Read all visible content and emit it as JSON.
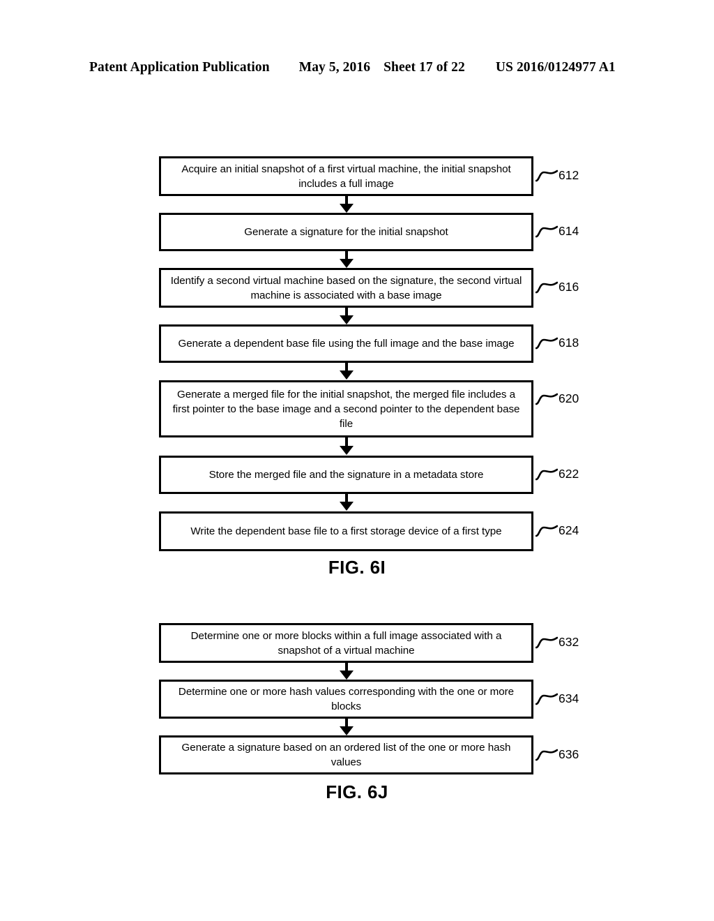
{
  "header": {
    "publication": "Patent Application Publication",
    "date": "May 5, 2016",
    "sheet": "Sheet 17 of 22",
    "patent_number": "US 2016/0124977 A1"
  },
  "figures": [
    {
      "caption": "FIG. 6I",
      "steps": [
        {
          "ref": "612",
          "text": "Acquire an initial snapshot of a first virtual machine, the initial snapshot includes a full image"
        },
        {
          "ref": "614",
          "text": "Generate a signature for the initial snapshot"
        },
        {
          "ref": "616",
          "text": "Identify a second virtual machine based on the signature, the second virtual machine is associated with a base image"
        },
        {
          "ref": "618",
          "text": "Generate a dependent base file using the full image and the base image"
        },
        {
          "ref": "620",
          "text": "Generate a merged file for the initial snapshot, the merged file includes a first pointer to the base image and a second pointer to the dependent base file"
        },
        {
          "ref": "622",
          "text": "Store the merged file and the signature in a metadata store"
        },
        {
          "ref": "624",
          "text": "Write the dependent base file to a first storage device of a first type"
        }
      ]
    },
    {
      "caption": "FIG. 6J",
      "steps": [
        {
          "ref": "632",
          "text": "Determine one or more blocks within a full image associated with a snapshot of a virtual machine"
        },
        {
          "ref": "634",
          "text": "Determine one or more hash values corresponding with the one or more blocks"
        },
        {
          "ref": "636",
          "text": "Generate a signature based on an ordered list of the one or more hash values"
        }
      ]
    }
  ],
  "colors": {
    "ink": "#000000",
    "paper": "#ffffff"
  }
}
